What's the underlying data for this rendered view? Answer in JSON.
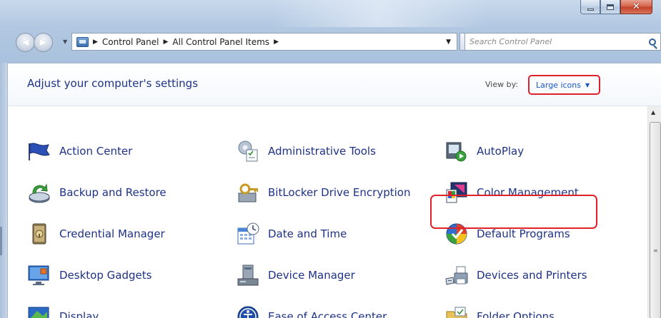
{
  "window": {
    "caption": {
      "minimize_glyph": "minimize",
      "maximize_glyph": "maximize",
      "close_glyph": "✕"
    }
  },
  "nav": {
    "back_glyph": "◀",
    "forward_glyph": "▶",
    "breadcrumb": [
      "Control Panel",
      "All Control Panel Items"
    ],
    "search_placeholder": "Search Control Panel"
  },
  "header": {
    "title": "Adjust your computer's settings",
    "view_by_label": "View by:",
    "view_by_value": "Large icons"
  },
  "items": [
    {
      "label": "Action Center",
      "icon": "flag-icon"
    },
    {
      "label": "Administrative Tools",
      "icon": "admin-tools-icon"
    },
    {
      "label": "AutoPlay",
      "icon": "autoplay-icon"
    },
    {
      "label": "Backup and Restore",
      "icon": "backup-icon"
    },
    {
      "label": "BitLocker Drive Encryption",
      "icon": "bitlocker-icon"
    },
    {
      "label": "Color Management",
      "icon": "color-management-icon"
    },
    {
      "label": "Credential Manager",
      "icon": "credential-icon"
    },
    {
      "label": "Date and Time",
      "icon": "calendar-clock-icon"
    },
    {
      "label": "Default Programs",
      "icon": "default-programs-icon"
    },
    {
      "label": "Desktop Gadgets",
      "icon": "gadgets-icon"
    },
    {
      "label": "Device Manager",
      "icon": "device-manager-icon"
    },
    {
      "label": "Devices and Printers",
      "icon": "printer-icon"
    },
    {
      "label": "Display",
      "icon": "display-icon"
    },
    {
      "label": "Ease of Access Center",
      "icon": "ease-of-access-icon"
    },
    {
      "label": "Folder Options",
      "icon": "folder-options-icon"
    }
  ],
  "colors": {
    "link": "#1e3287",
    "highlight": "#e0202a",
    "view_by_value": "#1a57c4"
  }
}
